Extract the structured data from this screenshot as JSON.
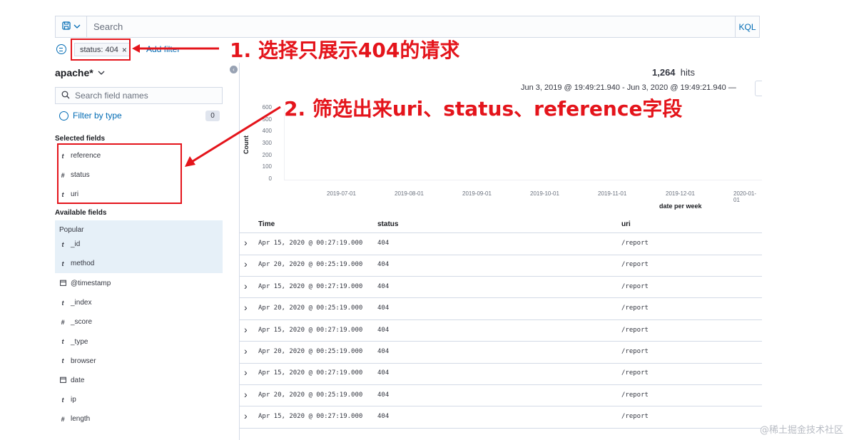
{
  "querybar": {
    "search_placeholder": "Search",
    "language": "KQL"
  },
  "filters": {
    "pill_label": "status: 404",
    "pill_close": "×",
    "add_filter": "Add filter"
  },
  "sidebar": {
    "index_pattern": "apache*",
    "search_placeholder": "Search field names",
    "filter_by_type": "Filter by type",
    "filter_count": "0",
    "selected_title": "Selected fields",
    "selected_fields": [
      {
        "type": "t",
        "name": "reference"
      },
      {
        "type": "#",
        "name": "status"
      },
      {
        "type": "t",
        "name": "uri"
      }
    ],
    "available_title": "Available fields",
    "popular_label": "Popular",
    "popular_fields": [
      {
        "type": "t",
        "name": "_id"
      },
      {
        "type": "t",
        "name": "method"
      }
    ],
    "available_fields": [
      {
        "type": "calendar",
        "name": "@timestamp"
      },
      {
        "type": "t",
        "name": "_index"
      },
      {
        "type": "#",
        "name": "_score"
      },
      {
        "type": "t",
        "name": "_type"
      },
      {
        "type": "t",
        "name": "browser"
      },
      {
        "type": "calendar",
        "name": "date"
      },
      {
        "type": "t",
        "name": "ip"
      },
      {
        "type": "#",
        "name": "length"
      }
    ]
  },
  "results": {
    "hits_count": "1,264",
    "hits_label": "hits",
    "date_range": "Jun 3, 2019 @ 19:49:21.940 - Jun 3, 2020 @ 19:49:21.940 —"
  },
  "chart_data": {
    "type": "bar",
    "ylabel": "Count",
    "xlabel": "date per week",
    "y_ticks": [
      "600",
      "500",
      "400",
      "300",
      "200",
      "100",
      "0"
    ],
    "x_ticks": [
      "2019-07-01",
      "2019-08-01",
      "2019-09-01",
      "2019-10-01",
      "2019-11-01",
      "2019-12-01",
      "2020-01-01"
    ],
    "ylim": [
      0,
      600
    ]
  },
  "table": {
    "columns": [
      "Time",
      "status",
      "uri"
    ],
    "rows": [
      {
        "time": "Apr 15, 2020 @ 00:27:19.000",
        "status": "404",
        "uri": "/report"
      },
      {
        "time": "Apr 20, 2020 @ 00:25:19.000",
        "status": "404",
        "uri": "/report"
      },
      {
        "time": "Apr 15, 2020 @ 00:27:19.000",
        "status": "404",
        "uri": "/report"
      },
      {
        "time": "Apr 20, 2020 @ 00:25:19.000",
        "status": "404",
        "uri": "/report"
      },
      {
        "time": "Apr 15, 2020 @ 00:27:19.000",
        "status": "404",
        "uri": "/report"
      },
      {
        "time": "Apr 20, 2020 @ 00:25:19.000",
        "status": "404",
        "uri": "/report"
      },
      {
        "time": "Apr 15, 2020 @ 00:27:19.000",
        "status": "404",
        "uri": "/report"
      },
      {
        "time": "Apr 20, 2020 @ 00:25:19.000",
        "status": "404",
        "uri": "/report"
      },
      {
        "time": "Apr 15, 2020 @ 00:27:19.000",
        "status": "404",
        "uri": "/report"
      }
    ]
  },
  "annotations": {
    "step1": "1. 选择只展示404的请求",
    "step2": "2. 筛选出来uri、status、reference字段",
    "color": "#e4141b"
  },
  "watermark": "@稀土掘金技术社区"
}
